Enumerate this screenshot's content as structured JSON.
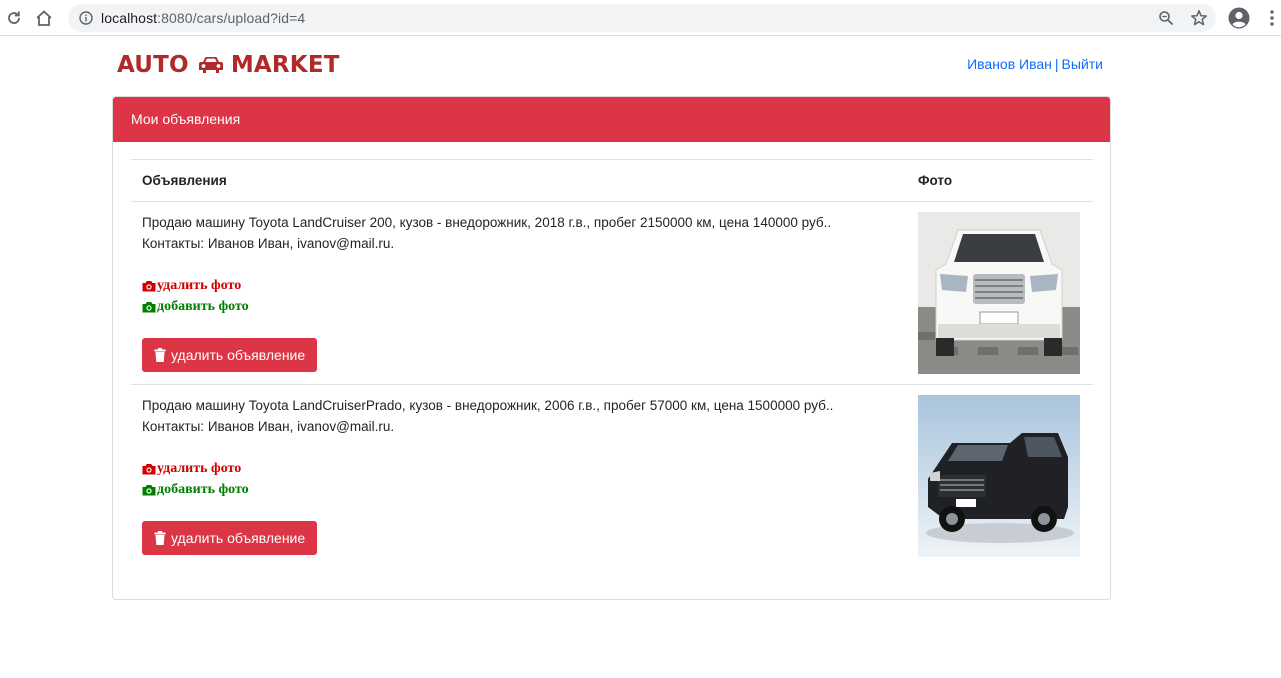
{
  "browser": {
    "url_host": "localhost",
    "url_rest": ":8080/cars/upload?id=4"
  },
  "header": {
    "brand_left": "AUTO",
    "brand_right": "MARKET",
    "brand_icon": "car-icon",
    "user_name": "Иванов Иван",
    "separator": "|",
    "logout": "Выйти"
  },
  "card": {
    "title": "Мои объявления",
    "columns": [
      "Объявления",
      "Фото"
    ],
    "ads": [
      {
        "description": "Продаю машину Toyota LandCruiser 200, кузов - внедорожник, 2018 г.в., пробег 2150000 км, цена 140000 руб..",
        "contacts": "Контакты: Иванов Иван, ivanov@mail.ru.",
        "delete_photo": "удалить фото",
        "add_photo": "добавить фото",
        "delete_ad": "удалить объявление",
        "photo": "white SUV front view"
      },
      {
        "description": "Продаю машину Toyota LandCruiserPrado, кузов - внедорожник, 2006 г.в., пробег 57000 км, цена 1500000 руб..",
        "contacts": "Контакты: Иванов Иван, ivanov@mail.ru.",
        "delete_photo": "удалить фото",
        "add_photo": "добавить фото",
        "delete_ad": "удалить объявление",
        "photo": "black SUV three-quarter view"
      }
    ]
  },
  "colors": {
    "primary_red": "#dc3545",
    "brand_red": "#b02a2a",
    "link_blue": "#0d6efd",
    "action_red": "#d00000",
    "action_green": "#008000"
  }
}
